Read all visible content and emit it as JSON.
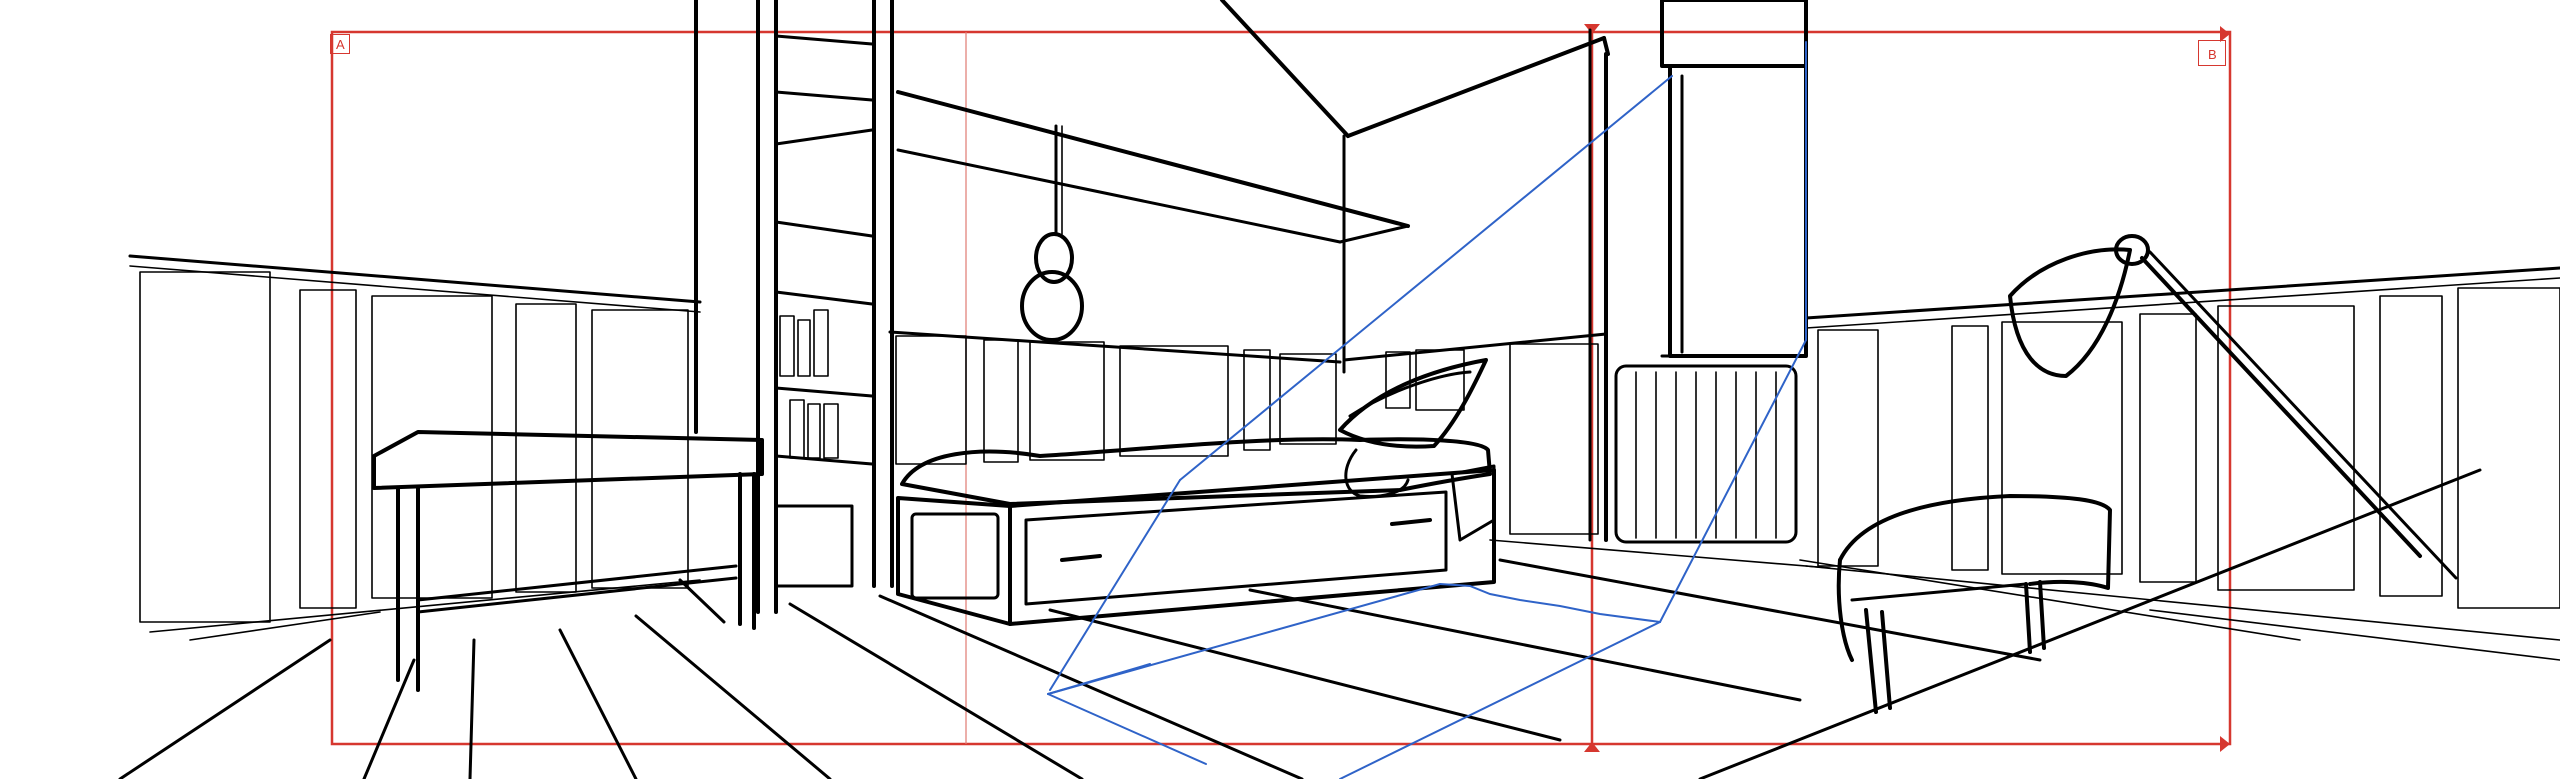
{
  "frame_markers": {
    "a": "A",
    "b": "B"
  },
  "colors": {
    "ink": "#000000",
    "frame": "#d6372f",
    "construction": "#2f63c8",
    "paper": "#ffffff"
  }
}
